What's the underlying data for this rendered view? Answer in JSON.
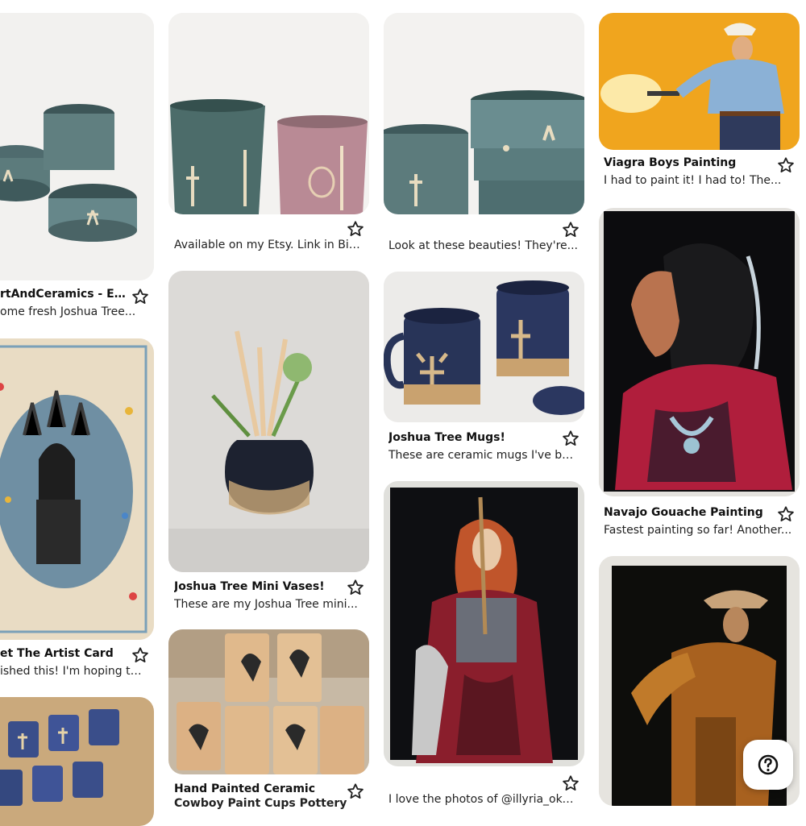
{
  "colors": {
    "accent": "#222222",
    "card_bg": "#f0efed"
  },
  "cards": {
    "bowls_left": {
      "title": "rtAndCeramics - Etsy",
      "desc": "ome fresh Joshua Tree..."
    },
    "cups_pair": {
      "title": "",
      "desc": "Available on my Etsy. Link in Bio...."
    },
    "bowls_stack": {
      "title": "",
      "desc": "Look at these beauties! They're..."
    },
    "viagra": {
      "title": "Viagra Boys Painting",
      "desc": "I had to paint it! I had to! The..."
    },
    "artist_card": {
      "title": "et The Artist Card",
      "desc": "ished this! I'm hoping to..."
    },
    "mini_vases": {
      "title": "Joshua Tree Mini Vases!",
      "desc": "These are my Joshua Tree mini..."
    },
    "mugs": {
      "title": "Joshua Tree Mugs!",
      "desc": "These are ceramic mugs I've be..."
    },
    "navajo": {
      "title": "Navajo Gouache Painting",
      "desc": "Fastest painting so far! Another..."
    },
    "cowboy_cups": {
      "title": "Hand Painted Ceramic",
      "desc": "Cowboy Paint Cups Pottery"
    },
    "knight": {
      "title": "",
      "desc": "I love the photos of @illyria_oka..."
    },
    "blue_mugs": {
      "title": "",
      "desc": ""
    },
    "cowboy_paint": {
      "title": "",
      "desc": ""
    }
  },
  "icons": {
    "save": "star-outline-icon",
    "help": "question-mark-icon"
  }
}
